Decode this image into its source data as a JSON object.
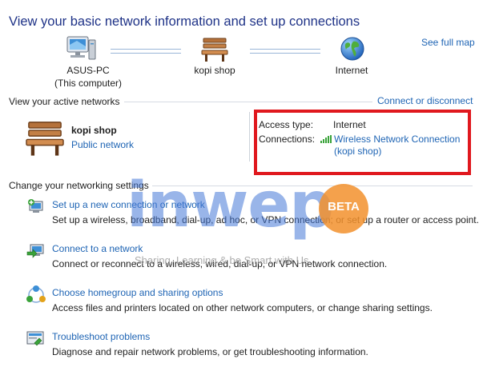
{
  "header": {
    "title": "View your basic network information and set up connections",
    "see_full_map": "See full map"
  },
  "map": {
    "nodes": [
      {
        "label": "ASUS-PC",
        "sublabel": "(This computer)",
        "icon": "computer-icon"
      },
      {
        "label": "kopi shop",
        "icon": "bench-icon"
      },
      {
        "label": "Internet",
        "icon": "globe-icon"
      }
    ]
  },
  "active_networks": {
    "heading": "View your active networks",
    "connect_link": "Connect or disconnect",
    "network": {
      "name": "kopi shop",
      "category": "Public network",
      "icon": "bench-icon"
    },
    "access_type_label": "Access type:",
    "access_type_value": "Internet",
    "connections_label": "Connections:",
    "connection_name": "Wireless Network Connection",
    "connection_ssid": "(kopi shop)",
    "signal_icon": "wifi-signal-icon"
  },
  "settings": {
    "heading": "Change your networking settings",
    "tasks": [
      {
        "link": "Set up a new connection or network",
        "desc": "Set up a wireless, broadband, dial-up, ad hoc, or VPN connection; or set up a router or access point.",
        "icon": "new-connection-icon"
      },
      {
        "link": "Connect to a network",
        "desc": "Connect or reconnect to a wireless, wired, dial-up, or VPN network connection.",
        "icon": "connect-network-icon"
      },
      {
        "link": "Choose homegroup and sharing options",
        "desc": "Access files and printers located on other network computers, or change sharing settings.",
        "icon": "homegroup-icon"
      },
      {
        "link": "Troubleshoot problems",
        "desc": "Diagnose and repair network problems, or get troubleshooting information.",
        "icon": "troubleshoot-icon"
      }
    ]
  },
  "watermark": {
    "brand": "inwep",
    "badge": "BETA",
    "tagline": "Sharing, Learning & be Smart with Us"
  },
  "colors": {
    "title": "#1e3287",
    "link": "#1e64b4",
    "highlight": "#e0181e",
    "watermark": "#4678d7",
    "badge": "#f2912d"
  }
}
